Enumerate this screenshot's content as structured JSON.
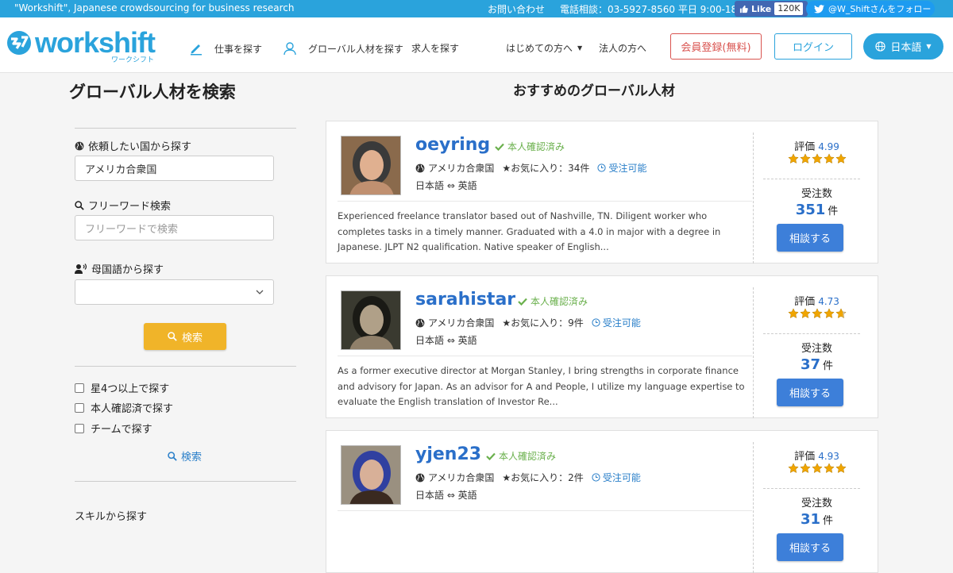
{
  "topbar": {
    "tagline": "\"Workshift\", Japanese crowdsourcing for business research",
    "contact": "お問い合わせ",
    "phone": "電話相談：03-5927-8560 平日 9:00-18:00",
    "fb_like": "Like",
    "fb_count": "120K",
    "twitter": "@W_Shiftさんをフォロー"
  },
  "header": {
    "logo_text": "workshift",
    "logo_kana": "ワークシフト",
    "nav_find_job": "仕事を探す",
    "nav_global": "グローバル人材を探す",
    "nav_recruit": "求人を探す",
    "nav_first": "はじめての方へ",
    "nav_corporate": "法人の方へ",
    "register": "会員登録(無料)",
    "login": "ログイン",
    "language": "日本語"
  },
  "sidebar": {
    "title": "グローバル人材を検索",
    "country_label": "依頼したい国から探す",
    "country_value": "アメリカ合衆国",
    "keyword_label": "フリーワード検索",
    "keyword_placeholder": "フリーワードで検索",
    "native_label": "母国語から探す",
    "native_value": "",
    "search_button": "検索",
    "filters": [
      "星4つ以上で探す",
      "本人確認済で探す",
      "チームで探す"
    ],
    "search_link": "検索",
    "skills_label": "スキルから探す"
  },
  "main": {
    "title": "おすすめのグローバル人材",
    "verified_label": "本人確認済み",
    "rating_label": "評価",
    "orders_label": "受注数",
    "orders_unit": "件",
    "consult_button": "相談する",
    "freelancers": [
      {
        "name": "oeyring",
        "country": "アメリカ合衆国",
        "favorites": "★お気に入り：34件",
        "availability": "受注可能",
        "languages": "日本語 ⇔ 英語",
        "description": "Experienced freelance translator based out of Nashville, TN. Diligent worker who completes tasks in a timely manner. Graduated with a 4.0 in major with a degree in Japanese. JLPT N2 qualification. Native speaker of English...",
        "rating": "4.99",
        "stars": 5,
        "orders": "351"
      },
      {
        "name": "sarahistar",
        "country": "アメリカ合衆国",
        "favorites": "★お気に入り：9件",
        "availability": "受注可能",
        "languages": "日本語 ⇔ 英語",
        "description": "As a former executive director at Morgan Stanley, I bring strengths in corporate finance and advisory for Japan. As an advisor for A and People, I utilize my language expertise to evaluate the English translation of Investor Re...",
        "rating": "4.73",
        "stars": 4.7,
        "orders": "37"
      },
      {
        "name": "yjen23",
        "country": "アメリカ合衆国",
        "favorites": "★お気に入り：2件",
        "availability": "受注可能",
        "languages": "日本語 ⇔ 英語",
        "description": "",
        "rating": "4.93",
        "stars": 5,
        "orders": "31"
      }
    ]
  },
  "colors": {
    "brand": "#2aa3dc",
    "link": "#2a6fc9",
    "verified": "#6ab04c",
    "star": "#f0a500",
    "search_button": "#f0b429",
    "register": "#d9534f",
    "consult": "#3d7fd9"
  }
}
